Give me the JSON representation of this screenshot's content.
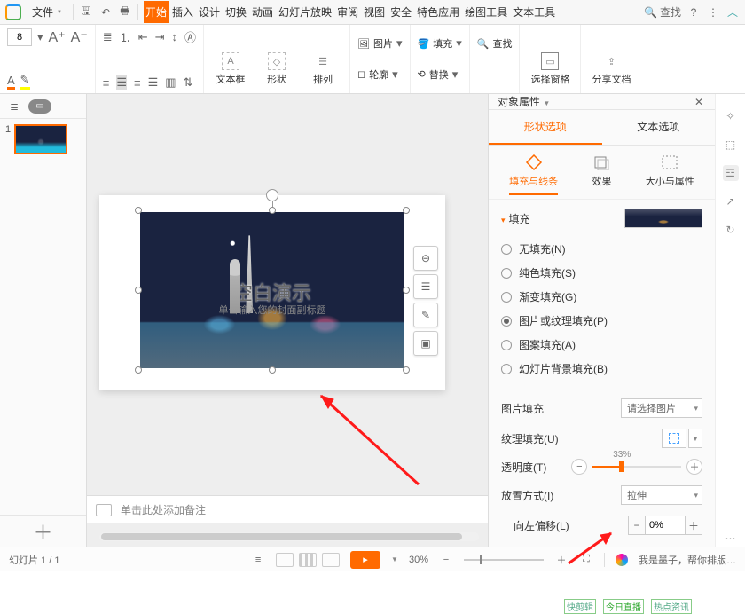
{
  "top": {
    "file": "文件",
    "search": "查找",
    "tabs": [
      "开始",
      "插入",
      "设计",
      "切换",
      "动画",
      "幻灯片放映",
      "审阅",
      "视图",
      "安全",
      "特色应用",
      "绘图工具",
      "文本工具"
    ]
  },
  "ribbon": {
    "font_size": "8",
    "textbox": "文本框",
    "shape": "形状",
    "arrange": "排列",
    "image": "图片",
    "fill": "填充",
    "outline": "轮廓",
    "find": "查找",
    "replace": "替换",
    "select_pane": "选择窗格",
    "share": "分享文档"
  },
  "thumb": {
    "index": "1"
  },
  "slide": {
    "title": "空白演示",
    "subtitle": "单击输入您的封面副标题"
  },
  "notes_placeholder": "单击此处添加备注",
  "panel": {
    "title": "对象属性",
    "tabs": {
      "shape": "形状选项",
      "text": "文本选项"
    },
    "subtabs": {
      "fill": "填充与线条",
      "effect": "效果",
      "size": "大小与属性"
    },
    "fill_section": "填充",
    "fill_options": {
      "none": "无填充(N)",
      "solid": "纯色填充(S)",
      "gradient": "渐变填充(G)",
      "picture": "图片或纹理填充(P)",
      "pattern": "图案填充(A)",
      "slidebg": "幻灯片背景填充(B)"
    },
    "labels": {
      "pic_fill": "图片填充",
      "texture": "纹理填充(U)",
      "opacity": "透明度(T)",
      "tile": "放置方式(I)",
      "offset_l": "向左偏移(L)"
    },
    "values": {
      "pic_fill": "请选择图片",
      "opacity_pct": "33%",
      "tile": "拉伸",
      "offset_l": "0%"
    }
  },
  "status": {
    "slide_info": "幻灯片 1 / 1",
    "zoom": "30%",
    "ai": "我是墨子，帮你排版…"
  },
  "taskbar": {
    "a": "快剪辑",
    "b": "今日直播",
    "c": "热点资讯"
  }
}
